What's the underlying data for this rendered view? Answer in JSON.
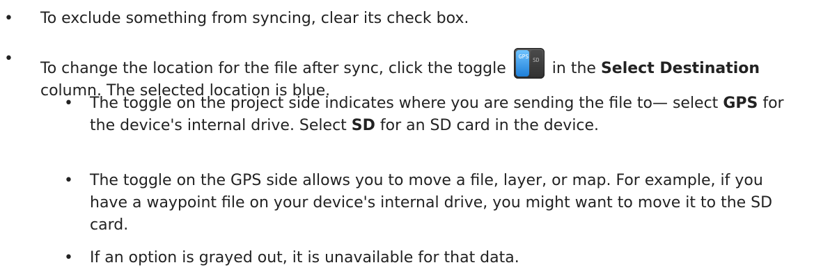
{
  "items": [
    {
      "text": "To exclude something from syncing, clear its check box."
    },
    {
      "before_icon": "To change the location for the file after sync, click the toggle",
      "icon": "gps-sd-toggle-icon",
      "icon_gps_label": "GPS",
      "icon_sd_label": "SD",
      "after_icon": " in the ",
      "bold1": "Select Destination",
      "after_bold1": " column. The selected location is blue.",
      "subitems": [
        {
          "part1": "The toggle on the project side indicates where you are sending the file to— select ",
          "bold1": "GPS",
          "part2": " for the device's internal drive. Select ",
          "bold2": "SD",
          "part3": " for an SD card in the device."
        },
        {
          "text": "The toggle on the GPS side allows you to move a file, layer, or map. For example, if you have a waypoint file on your device's internal drive, you might want to move it to the SD card."
        },
        {
          "text": "If an option is grayed out, it is unavailable for that data."
        }
      ]
    }
  ],
  "colors": {
    "text": "#222222",
    "toggle_selected": "#1e7fd8",
    "toggle_body": "#3a3a3a"
  }
}
